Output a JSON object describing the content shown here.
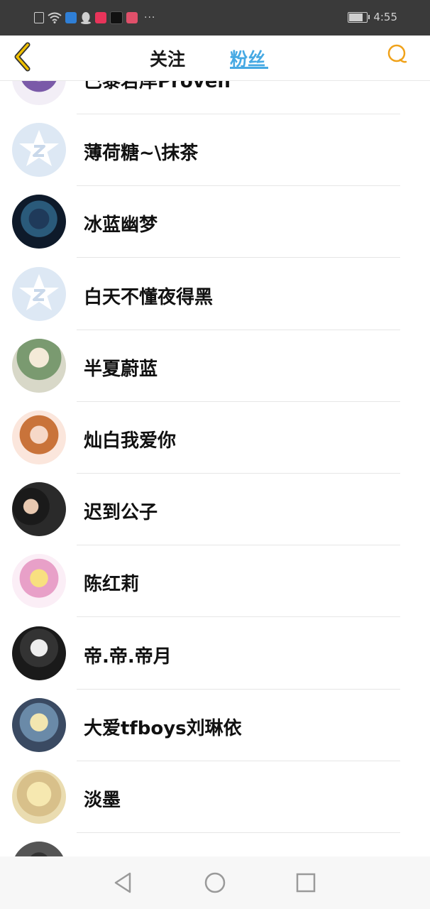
{
  "status_bar": {
    "time": "4:55",
    "battery_level": 0.85,
    "notification_icons": [
      "alert-icon",
      "wifi-icon",
      "shield-app-icon",
      "qq-icon",
      "music-app-icon",
      "tiktok-icon",
      "calendar-app-icon"
    ],
    "overflow": "···"
  },
  "header": {
    "tabs": [
      {
        "label": "关注",
        "active": false
      },
      {
        "label": "粉丝",
        "active": true
      }
    ],
    "accent_color": "#46a9e3",
    "back_color": "#f0a21a",
    "search_color": "#f0a21a"
  },
  "fans": [
    {
      "name": "巴黎若岸Proven",
      "avatar": "anime-avatar"
    },
    {
      "name": "薄荷糖~\\抹茶",
      "avatar": "default-avatar"
    },
    {
      "name": "冰蓝幽梦",
      "avatar": "anime-avatar"
    },
    {
      "name": "白天不懂夜得黑",
      "avatar": "default-avatar"
    },
    {
      "name": "半夏蔚蓝",
      "avatar": "photo-avatar"
    },
    {
      "name": "灿白我爱你",
      "avatar": "anime-avatar"
    },
    {
      "name": "迟到公子",
      "avatar": "photo-avatar"
    },
    {
      "name": "陈红莉",
      "avatar": "anime-avatar"
    },
    {
      "name": "帝.帝.帝月",
      "avatar": "photo-avatar"
    },
    {
      "name": "大爱tfboys刘琳依",
      "avatar": "anime-avatar"
    },
    {
      "name": "淡墨",
      "avatar": "anime-avatar"
    },
    {
      "name": "",
      "avatar": "photo-avatar"
    }
  ],
  "nav_bar": {
    "icons": [
      "back-triangle-icon",
      "home-circle-icon",
      "recents-square-icon"
    ]
  }
}
